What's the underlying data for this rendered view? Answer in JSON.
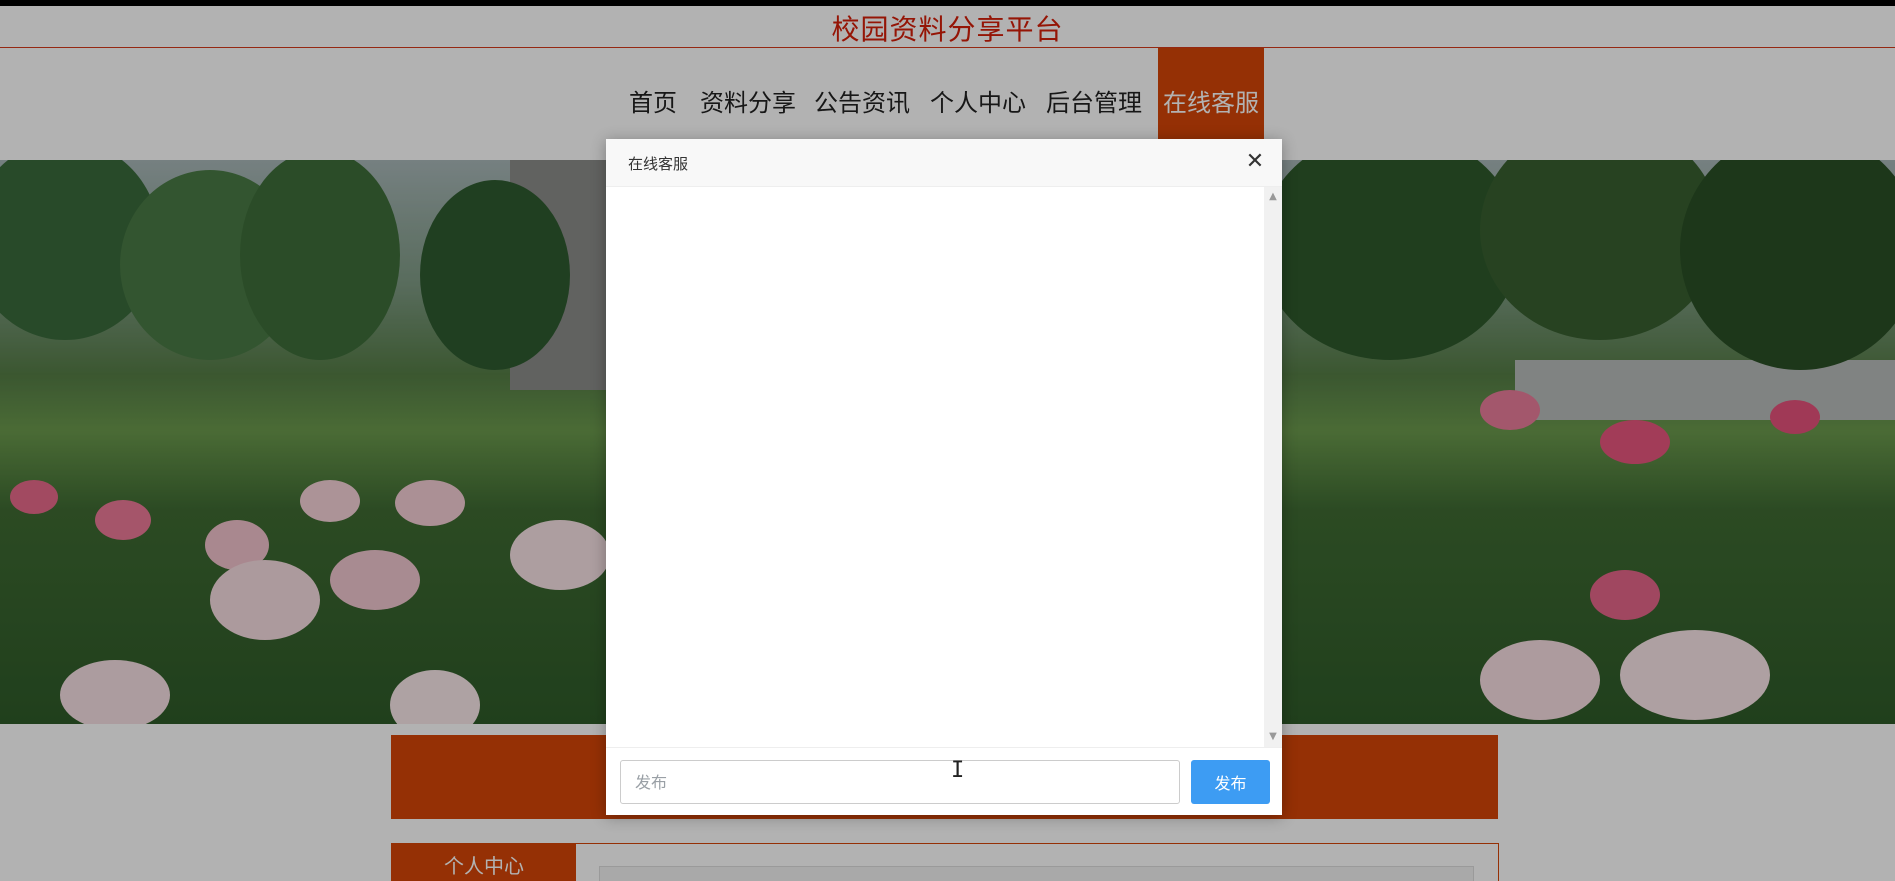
{
  "site": {
    "title": "校园资料分享平台"
  },
  "nav": {
    "items": [
      {
        "label": "首页",
        "active": false
      },
      {
        "label": "资料分享",
        "active": false
      },
      {
        "label": "公告资讯",
        "active": false
      },
      {
        "label": "个人中心",
        "active": false
      },
      {
        "label": "后台管理",
        "active": false
      },
      {
        "label": "在线客服",
        "active": true
      }
    ]
  },
  "panel": {
    "tab_label": "个人中心"
  },
  "dialog": {
    "title": "在线客服",
    "close_symbol": "✕",
    "input_placeholder": "发布",
    "send_label": "发布",
    "scroll_up_symbol": "▲",
    "scroll_down_symbol": "▼"
  },
  "colors": {
    "brand": "#d64608",
    "title_red": "#d61f0a",
    "send_button": "#3d9cf3"
  }
}
